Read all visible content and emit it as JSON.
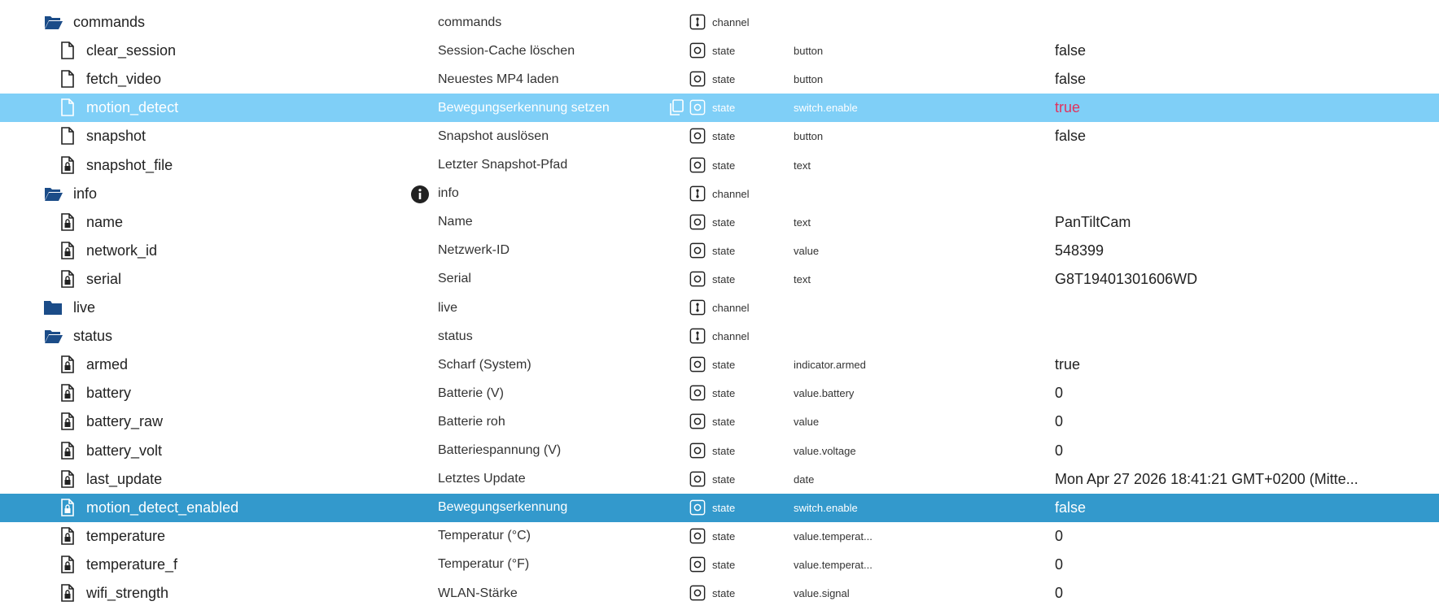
{
  "colors": {
    "folder": "#1b4c88",
    "highlight_light": "#7fcff7",
    "highlight_dark": "#3399cc",
    "value_true_highlight": "#e0325e"
  },
  "rows": [
    {
      "kind": "folder-open",
      "id": "commands",
      "name": "commands",
      "type": "channel",
      "role": "",
      "value": ""
    },
    {
      "kind": "file",
      "id": "clear_session",
      "name": "Session-Cache löschen",
      "type": "state",
      "role": "button",
      "value": "false"
    },
    {
      "kind": "file",
      "id": "fetch_video",
      "name": "Neuestes MP4 laden",
      "type": "state",
      "role": "button",
      "value": "false"
    },
    {
      "kind": "file",
      "id": "motion_detect",
      "name": "Bewegungserkennung setzen",
      "type": "state",
      "role": "switch.enable",
      "value": "true",
      "highlight": "light",
      "copy": true
    },
    {
      "kind": "file",
      "id": "snapshot",
      "name": "Snapshot auslösen",
      "type": "state",
      "role": "button",
      "value": "false"
    },
    {
      "kind": "file-lock",
      "id": "snapshot_file",
      "name": "Letzter Snapshot-Pfad",
      "type": "state",
      "role": "text",
      "value": ""
    },
    {
      "kind": "folder-open",
      "id": "info",
      "name": "info",
      "type": "channel",
      "role": "",
      "value": "",
      "info": true
    },
    {
      "kind": "file-lock",
      "id": "name",
      "name": "Name",
      "type": "state",
      "role": "text",
      "value": "PanTiltCam"
    },
    {
      "kind": "file-lock",
      "id": "network_id",
      "name": "Netzwerk-ID",
      "type": "state",
      "role": "value",
      "value": "548399"
    },
    {
      "kind": "file-lock",
      "id": "serial",
      "name": "Serial",
      "type": "state",
      "role": "text",
      "value": "G8T19401301606WD"
    },
    {
      "kind": "folder-closed",
      "id": "live",
      "name": "live",
      "type": "channel",
      "role": "",
      "value": ""
    },
    {
      "kind": "folder-open",
      "id": "status",
      "name": "status",
      "type": "channel",
      "role": "",
      "value": ""
    },
    {
      "kind": "file-lock",
      "id": "armed",
      "name": "Scharf (System)",
      "type": "state",
      "role": "indicator.armed",
      "value": "true"
    },
    {
      "kind": "file-lock",
      "id": "battery",
      "name": "Batterie (V)",
      "type": "state",
      "role": "value.battery",
      "value": "0"
    },
    {
      "kind": "file-lock",
      "id": "battery_raw",
      "name": "Batterie roh",
      "type": "state",
      "role": "value",
      "value": "0"
    },
    {
      "kind": "file-lock",
      "id": "battery_volt",
      "name": "Batteriespannung (V)",
      "type": "state",
      "role": "value.voltage",
      "value": "0"
    },
    {
      "kind": "file-lock",
      "id": "last_update",
      "name": "Letztes Update",
      "type": "state",
      "role": "date",
      "value": "Mon Apr 27 2026 18:41:21 GMT+0200 (Mitte..."
    },
    {
      "kind": "file-lock",
      "id": "motion_detect_enabled",
      "name": "Bewegungserkennung",
      "type": "state",
      "role": "switch.enable",
      "value": "false",
      "highlight": "dark"
    },
    {
      "kind": "file-lock",
      "id": "temperature",
      "name": "Temperatur (°C)",
      "type": "state",
      "role": "value.temperat...",
      "value": "0"
    },
    {
      "kind": "file-lock",
      "id": "temperature_f",
      "name": "Temperatur (°F)",
      "type": "state",
      "role": "value.temperat...",
      "value": "0"
    },
    {
      "kind": "file-lock",
      "id": "wifi_strength",
      "name": "WLAN-Stärke",
      "type": "state",
      "role": "value.signal",
      "value": "0"
    }
  ]
}
